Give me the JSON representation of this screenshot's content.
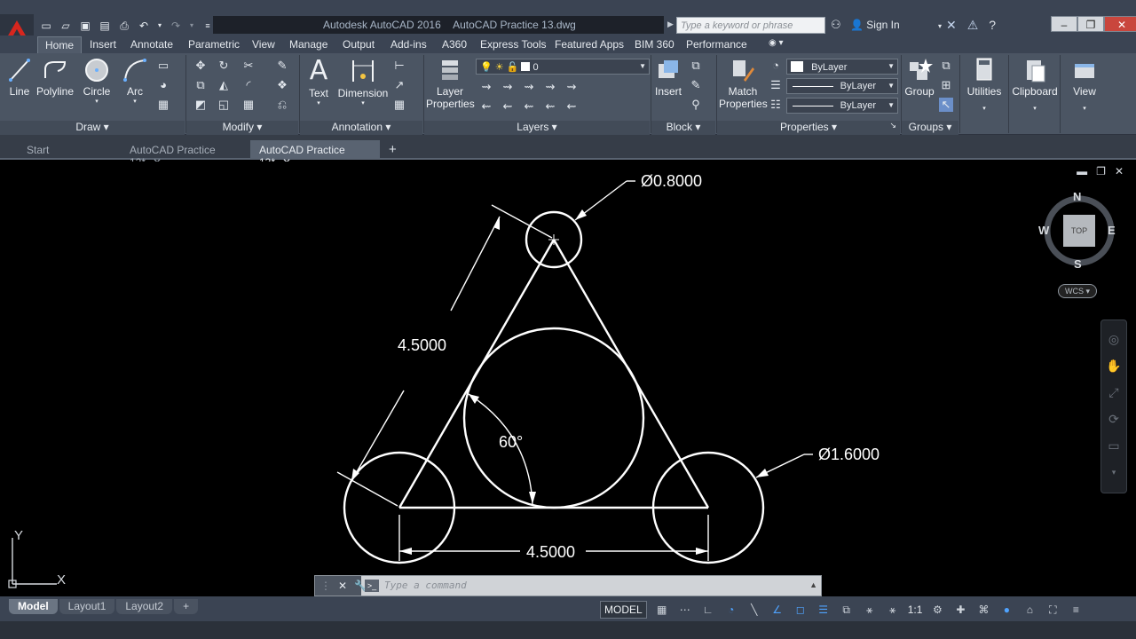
{
  "titlebar": {
    "app_title": "Autodesk AutoCAD 2016",
    "file_name": "AutoCAD Practice 13.dwg",
    "search_placeholder": "Type a keyword or phrase",
    "sign_in": "Sign In"
  },
  "ribbon_tabs": [
    "Home",
    "Insert",
    "Annotate",
    "Parametric",
    "View",
    "Manage",
    "Output",
    "Add-ins",
    "A360",
    "Express Tools",
    "Featured Apps",
    "BIM 360",
    "Performance"
  ],
  "ribbon": {
    "draw": {
      "footer": "Draw",
      "line": "Line",
      "polyline": "Polyline",
      "circle": "Circle",
      "arc": "Arc"
    },
    "modify": {
      "footer": "Modify"
    },
    "annotation": {
      "footer": "Annotation",
      "text": "Text",
      "dimension": "Dimension"
    },
    "layers": {
      "footer": "Layers",
      "layer_properties_1": "Layer",
      "layer_properties_2": "Properties",
      "current_layer": "0"
    },
    "block": {
      "footer": "Block",
      "insert": "Insert"
    },
    "properties": {
      "footer": "Properties",
      "match_1": "Match",
      "match_2": "Properties",
      "color": "ByLayer",
      "linetype": "ByLayer",
      "lineweight": "ByLayer"
    },
    "groups": {
      "footer": "Groups",
      "group": "Group"
    },
    "utilities": "Utilities",
    "clipboard": "Clipboard",
    "view": "View"
  },
  "file_tabs": [
    {
      "label": "Start"
    },
    {
      "label": "AutoCAD Practice 12*"
    },
    {
      "label": "AutoCAD Practice 13*"
    }
  ],
  "drawing": {
    "dim_small_diameter": "Ø0.8000",
    "dim_large_diameter": "Ø1.6000",
    "dim_side": "4.5000",
    "dim_base": "4.5000",
    "dim_angle": "60°"
  },
  "viewcube": {
    "top": "TOP",
    "n": "N",
    "s": "S",
    "e": "E",
    "w": "W",
    "wcs": "WCS"
  },
  "ucs": {
    "x": "X",
    "y": "Y"
  },
  "command": {
    "placeholder": "Type a command"
  },
  "status": {
    "layouts": [
      "Model",
      "Layout1",
      "Layout2"
    ],
    "model_button": "MODEL",
    "scale": "1:1"
  }
}
